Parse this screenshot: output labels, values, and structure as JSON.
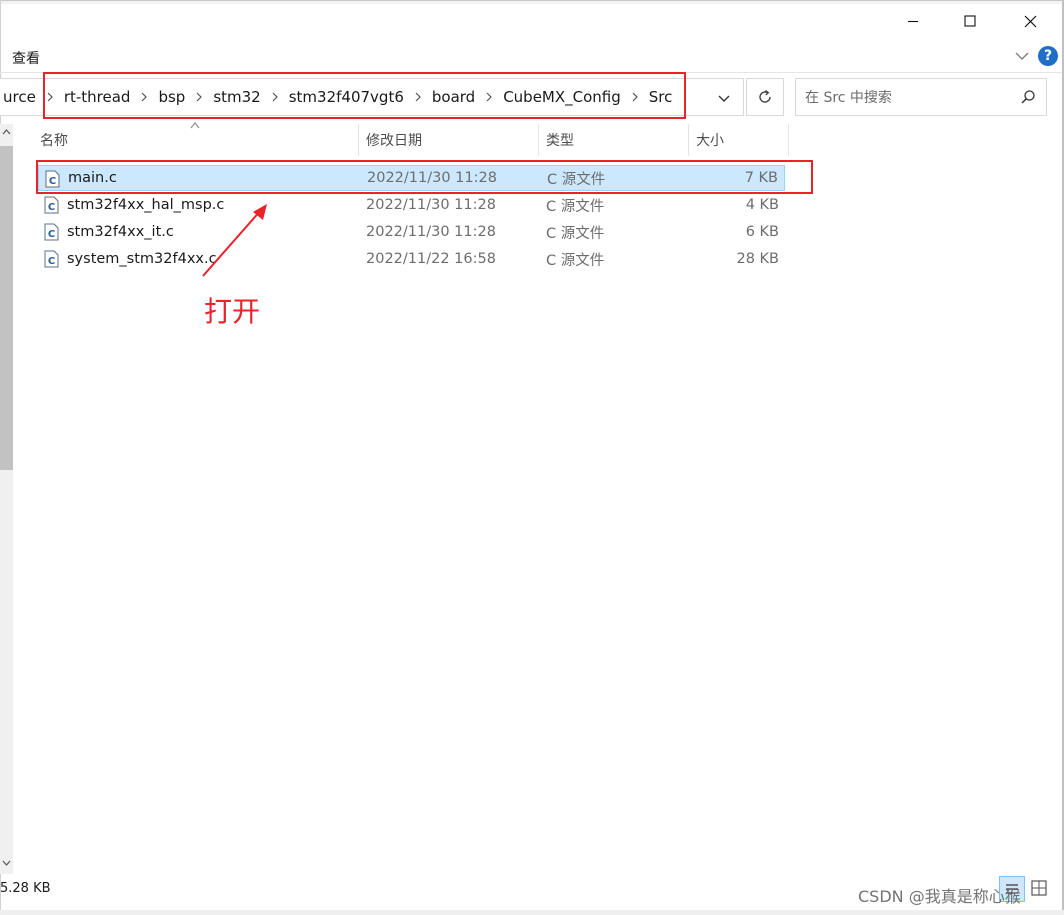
{
  "window": {
    "controls": [
      "minimize-icon",
      "maximize-icon",
      "close-icon"
    ]
  },
  "ribbon": {
    "view_tab": "查看",
    "collapse_icon": "chevron-down-icon",
    "help_label": "?"
  },
  "address_bar": {
    "crumbs": [
      "urce",
      "rt-thread",
      "bsp",
      "stm32",
      "stm32f407vgt6",
      "board",
      "CubeMX_Config",
      "Src"
    ],
    "separator_icon": "chevron-right-icon",
    "dropdown_icon": "chevron-down-icon",
    "refresh_icon": "refresh-icon"
  },
  "search": {
    "placeholder": "在 Src 中搜索",
    "icon": "search-icon"
  },
  "columns": {
    "name": "名称",
    "date": "修改日期",
    "type": "类型",
    "size": "大小"
  },
  "files": [
    {
      "name": "main.c",
      "date": "2022/11/30 11:28",
      "type": "C 源文件",
      "size": "7 KB",
      "selected": true
    },
    {
      "name": "stm32f4xx_hal_msp.c",
      "date": "2022/11/30 11:28",
      "type": "C 源文件",
      "size": "4 KB",
      "selected": false
    },
    {
      "name": "stm32f4xx_it.c",
      "date": "2022/11/30 11:28",
      "type": "C 源文件",
      "size": "6 KB",
      "selected": false
    },
    {
      "name": "system_stm32f4xx.c",
      "date": "2022/11/22 16:58",
      "type": "C 源文件",
      "size": "28 KB",
      "selected": false
    }
  ],
  "annotation": {
    "text": "打开",
    "color": "#e8232a"
  },
  "status_bar": {
    "selection_size": "5.28 KB"
  },
  "watermark": "CSDN @我真是称心猴",
  "colors": {
    "selection_bg": "#cce8ff",
    "highlight_red": "#e8232a",
    "help_blue": "#1f6fc5"
  }
}
